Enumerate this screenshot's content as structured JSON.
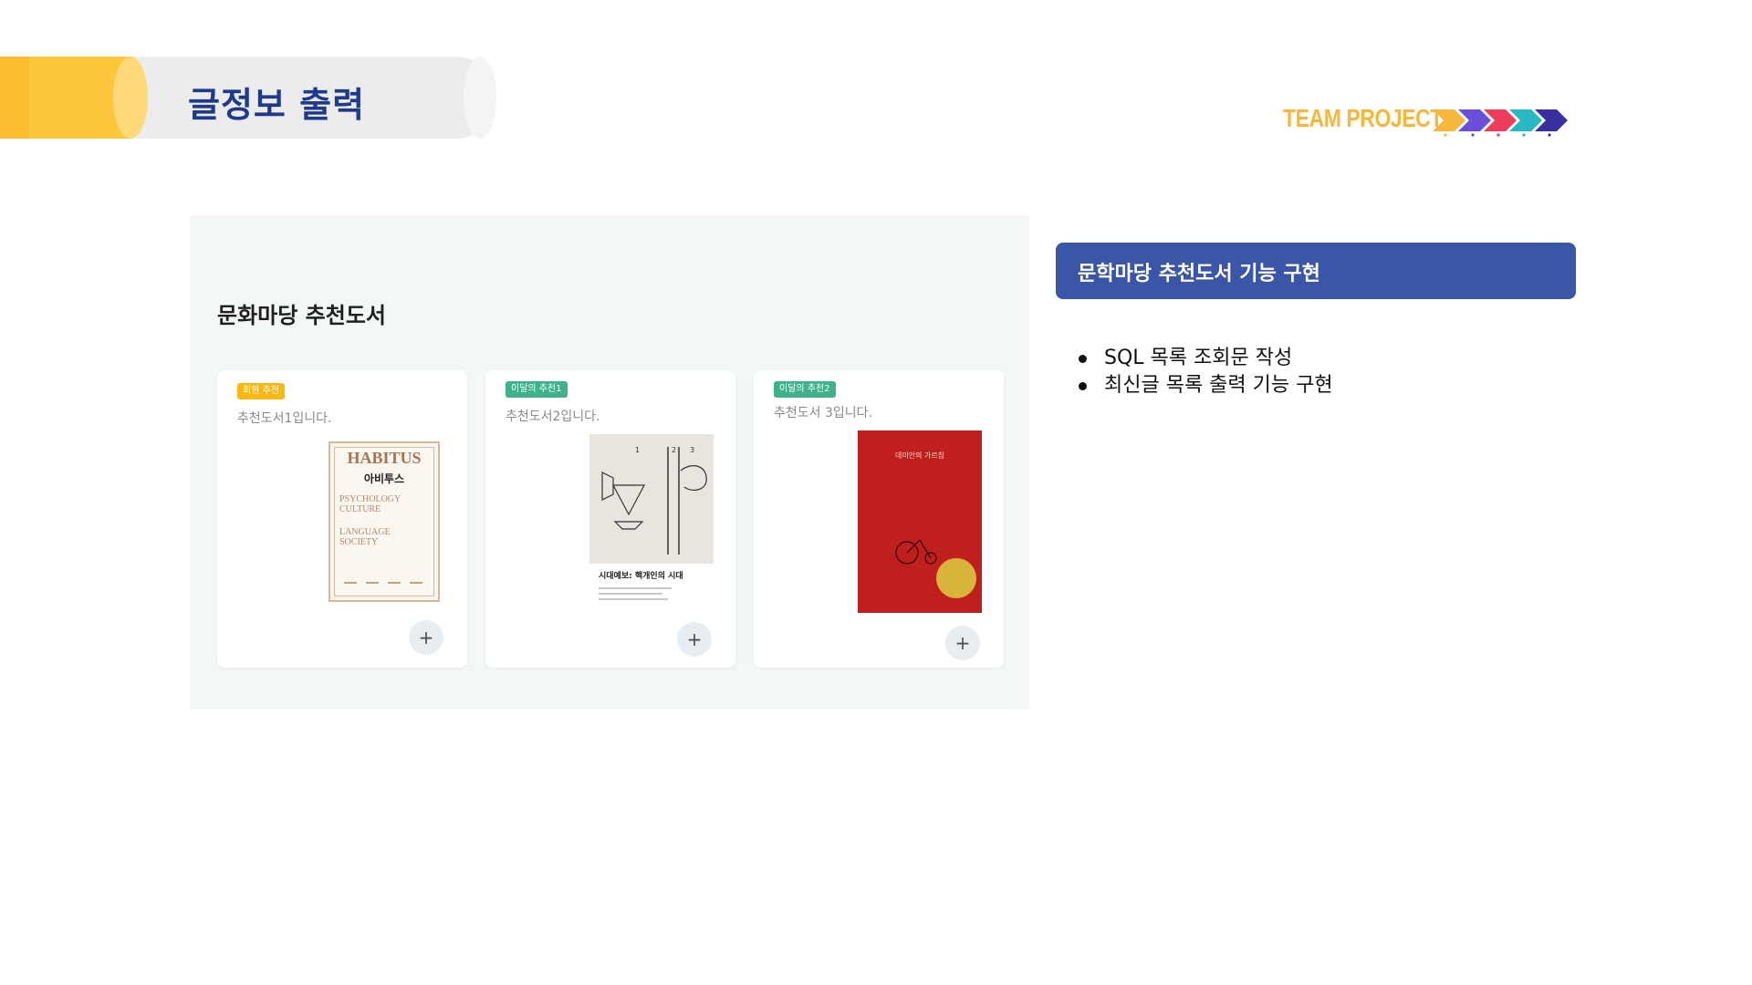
{
  "header": {
    "title": "글정보 출력",
    "logo_text": "TEAM PROJECT",
    "logo_arrow_colors": [
      "#f5b83d",
      "#6a4fd8",
      "#ee3c5c",
      "#27b8c4",
      "#3a2fa0"
    ]
  },
  "panel": {
    "heading": "문화마당 추천도서",
    "cards": [
      {
        "badge": "회원 추천",
        "description": "추천도서1입니다.",
        "cover": {
          "title": "HABITUS",
          "subtitle": "아비투스",
          "lines": [
            "PSYCHOLOGY",
            "CULTURE",
            "LANGUAGE",
            "SOCIETY"
          ]
        }
      },
      {
        "badge": "이달의 추천1",
        "description": "추천도서2입니다.",
        "cover": {
          "title": "시대예보: 핵개인의 시대"
        }
      },
      {
        "badge": "이달의 추천2",
        "description": "추천도서 3입니다.",
        "cover": {
          "title": "데미안의 가르침"
        }
      }
    ],
    "add_label": "+"
  },
  "feature": {
    "title": "문학마당 추천도서 기능 구현",
    "bullets": [
      "SQL 목록 조회문 작성",
      "최신글 목록 출력 기능 구현"
    ]
  },
  "colors": {
    "title_blue": "#1e3a8c",
    "banner_yellow": "#fcc63d",
    "feature_box": "#3b55a7",
    "badge_yellow": "#f5b814",
    "badge_green": "#3fb28a"
  }
}
